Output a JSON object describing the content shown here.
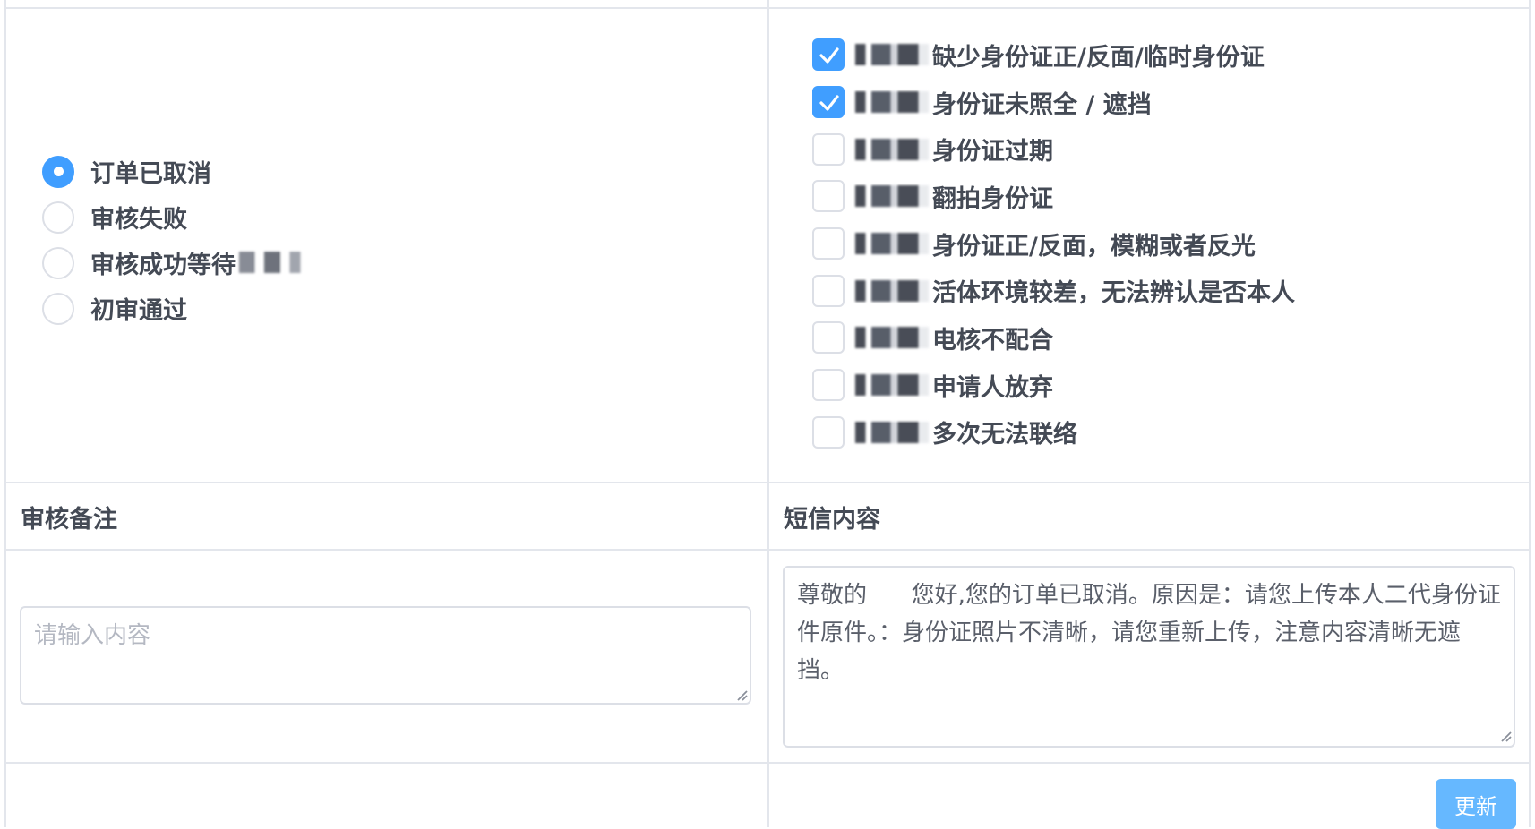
{
  "status": {
    "options": [
      {
        "label": "订单已取消",
        "selected": true
      },
      {
        "label": "审核失败",
        "selected": false
      },
      {
        "label": "审核成功等待",
        "selected": false,
        "redacted_suffix": true
      },
      {
        "label": "初审通过",
        "selected": false
      }
    ]
  },
  "reasons": {
    "items": [
      {
        "label": "缺少身份证正/反面/临时身份证",
        "checked": true
      },
      {
        "label": "身份证未照全 / 遮挡",
        "checked": true
      },
      {
        "label": "身份证过期",
        "checked": false
      },
      {
        "label": "翻拍身份证",
        "checked": false
      },
      {
        "label": "身份证正/反面，模糊或者反光",
        "checked": false
      },
      {
        "label": "活体环境较差，无法辨认是否本人",
        "checked": false
      },
      {
        "label": "电核不配合",
        "checked": false
      },
      {
        "label": "申请人放弃",
        "checked": false
      },
      {
        "label": "多次无法联络",
        "checked": false
      }
    ]
  },
  "remark": {
    "title": "审核备注",
    "placeholder": "请输入内容",
    "value": ""
  },
  "sms": {
    "title": "短信内容",
    "value_prefix": "尊敬的",
    "value": "尊敬的      您好,您的订单已取消。原因是：请您上传本人二代身份证件原件。：身份证照片不清晰，请您重新上传，注意内容清晰无遮挡。"
  },
  "actions": {
    "update_label": "更新"
  },
  "colors": {
    "primary": "#409eff",
    "button": "#66b8ff",
    "border": "#dcdfe6"
  }
}
